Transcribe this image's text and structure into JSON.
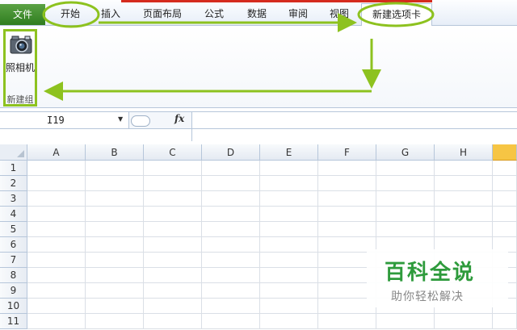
{
  "ribbon": {
    "tabs": [
      "文件",
      "开始",
      "插入",
      "页面布局",
      "公式",
      "数据",
      "审阅",
      "视图",
      "新建选项卡"
    ],
    "active_tab": "新建选项卡",
    "group": {
      "command_label": "照相机",
      "command_icon": "camera-icon",
      "group_label": "新建组"
    }
  },
  "formula_bar": {
    "name_box": "I19",
    "fx_label": "fx",
    "formula": ""
  },
  "grid": {
    "columns": [
      "A",
      "B",
      "C",
      "D",
      "E",
      "F",
      "G",
      "H",
      ""
    ],
    "selected_column": "I",
    "rows": [
      "1",
      "2",
      "3",
      "4",
      "5",
      "6",
      "7",
      "8",
      "9",
      "10",
      "11"
    ]
  },
  "colors": {
    "annotation": "#8dc21f",
    "file_tab": "#2f7d1f",
    "selected_header": "#f6c544"
  },
  "watermark": {
    "title": "百科全说",
    "subtitle": "助你轻松解决"
  }
}
